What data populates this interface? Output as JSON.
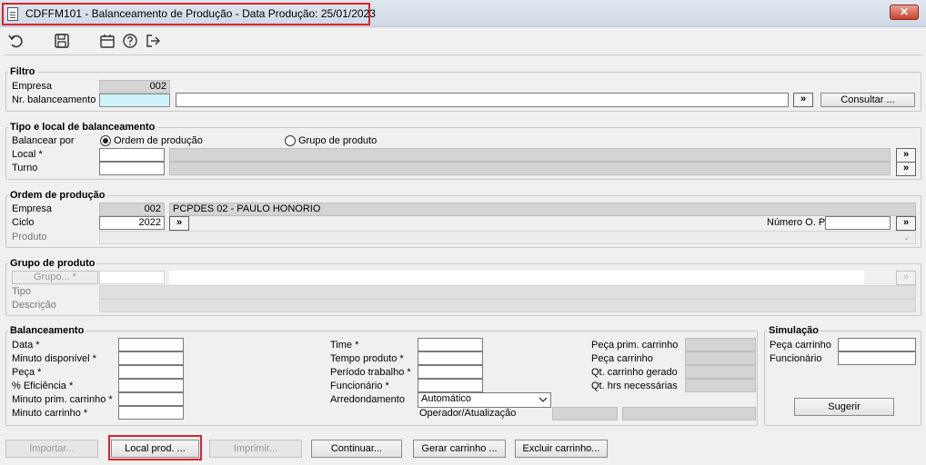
{
  "window": {
    "title": "CDFFM101 - Balanceamento de Produção - Data Produção:  25/01/2023",
    "close_label": "✕"
  },
  "toolbar": {
    "icons": [
      "undo-icon",
      "save-icon",
      "calendar-icon",
      "help-icon",
      "exit-icon"
    ]
  },
  "filtro": {
    "legend": "Filtro",
    "empresa_label": "Empresa",
    "empresa_value": "002",
    "nr_balanceamento_label": "Nr. balanceamento",
    "nr_balanceamento_value": "",
    "descricao_value": "",
    "lookup_label": "»",
    "consultar_label": "Consultar ..."
  },
  "tipo_local": {
    "legend": "Tipo e local de balanceamento",
    "balancear_por_label": "Balancear por",
    "option_ordem": "Ordem de produção",
    "option_grupo": "Grupo de produto",
    "selected": "Ordem de produção",
    "local_label": "Local *",
    "turno_label": "Turno",
    "lookup_label": "»"
  },
  "ordem_producao": {
    "legend": "Ordem de produção",
    "empresa_label": "Empresa",
    "empresa_value": "002",
    "empresa_nome": "PCPDES 02 - PAULO HONORIO",
    "ciclo_label": "Ciclo",
    "ciclo_value": "2022",
    "numero_op_label": "Número O. P.",
    "numero_op_value": "",
    "produto_label": "Produto",
    "lookup_label": "»"
  },
  "grupo_produto": {
    "legend": "Grupo de produto",
    "grupo_button": "Grupo... *",
    "tipo_label": "Tipo",
    "descricao_label": "Descrição",
    "lookup_label": "»"
  },
  "balanceamento": {
    "legend": "Balanceamento",
    "data_label": "Data *",
    "minuto_disponivel_label": "Minuto disponível *",
    "peca_label": "Peça *",
    "eficiencia_label": "% Eficiência *",
    "minuto_prim_carrinho_label": "Minuto prim. carrinho *",
    "minuto_carrinho_label": "Minuto carrinho *",
    "time_label": "Time *",
    "tempo_produto_label": "Tempo produto *",
    "periodo_trabalho_label": "Período trabalho *",
    "funcionario_label": "Funcionário *",
    "arredondamento_label": "Arredondamento",
    "arredondamento_value": "Automático",
    "operador_label": "Operador/Atualização",
    "peca_prim_carrinho_label": "Peça prim. carrinho",
    "peca_carrinho_label": "Peça carrinho",
    "qt_carrinho_gerado_label": "Qt. carrinho gerado",
    "qt_hrs_necessarias_label": "Qt. hrs necessárias"
  },
  "simulacao": {
    "legend": "Simulação",
    "peca_carrinho_label": "Peça carrinho",
    "funcionario_label": "Funcionário",
    "sugerir_label": "Sugerir"
  },
  "actions": {
    "importar": "Importar...",
    "local_prod": "Local prod. ...",
    "imprimir": "Imprimir...",
    "continuar": "Continuar...",
    "gerar_carrinho": "Gerar carrinho ...",
    "excluir_carrinho": "Excluir carrinho..."
  }
}
